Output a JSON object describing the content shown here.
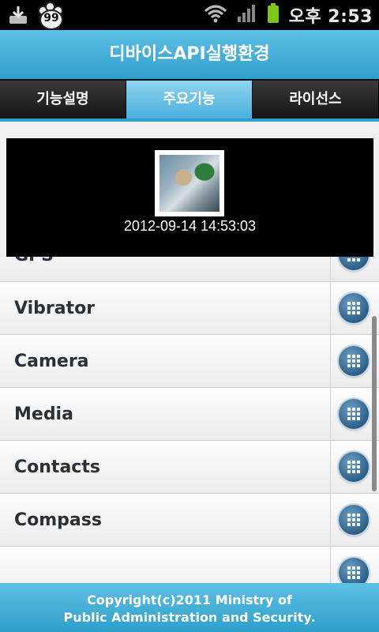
{
  "status_bar": {
    "notification_badge": "99",
    "time": "오후 2:53",
    "icons": [
      "download-icon",
      "paw-badge-icon",
      "wifi-icon",
      "signal-icon",
      "battery-icon"
    ]
  },
  "header": {
    "title": "디바이스API실행환경"
  },
  "tabs": [
    {
      "label": "기능설명",
      "active": false
    },
    {
      "label": "주요기능",
      "active": true
    },
    {
      "label": "라이선스",
      "active": false
    }
  ],
  "photo": {
    "timestamp": "2012-09-14 14:53:03"
  },
  "list": {
    "items": [
      "GPS",
      "Vibrator",
      "Camera",
      "Media",
      "Contacts",
      "Compass",
      ""
    ]
  },
  "footer": {
    "line1": "Copyright(c)2011 Ministry of",
    "line2": "Public Administration and Security."
  },
  "colors": {
    "accent": "#2e9fcc",
    "active_tab": "#4aaedc",
    "list_button": "#2c5f88"
  }
}
